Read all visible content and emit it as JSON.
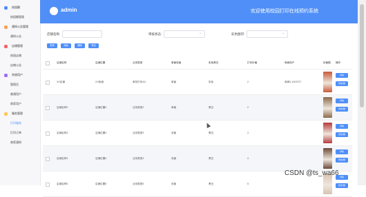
{
  "header": {
    "logo_text": "admin",
    "title": "欢迎使用校园打印在线预约系统"
  },
  "sidebar": {
    "groups": [
      {
        "label": "校园圈",
        "color": "#4f8ff7",
        "items": [
          {
            "label": "校园圈管理",
            "active": false
          }
        ]
      },
      {
        "label": "通知公告管理",
        "color": "#f7a04f",
        "items": [
          {
            "label": "通知公告",
            "active": false
          }
        ]
      },
      {
        "label": "店铺管理",
        "color": "#f76262",
        "items": [
          {
            "label": "校园店铺",
            "active": false
          },
          {
            "label": "店铺公告",
            "active": false
          }
        ]
      },
      {
        "label": "系统用户",
        "color": "#9b6cf7",
        "items": [
          {
            "label": "管理员",
            "active": false
          },
          {
            "label": "普通用户",
            "active": false
          },
          {
            "label": "商家用户",
            "active": false
          }
        ]
      },
      {
        "label": "服务管理",
        "color": "#f7c94f",
        "items": [
          {
            "label": "打印服务",
            "active": true
          },
          {
            "label": "打印订单",
            "active": false
          },
          {
            "label": "商家通知",
            "active": false
          }
        ]
      }
    ]
  },
  "search": {
    "field1_label": "店铺名称:",
    "field2_label": "审核状态:",
    "field3_label": "彩色图印:"
  },
  "toolbar": {
    "query": "查询",
    "add": "添加",
    "delete": "删除",
    "export": "导出"
  },
  "table": {
    "headers": [
      "店铺名称",
      "店铺位置",
      "业务类型",
      "单面双面",
      "彩色黑白",
      "打印价格",
      "商家用户",
      "封面图",
      "操作"
    ],
    "rows": [
      {
        "name": "XX店铺",
        "loc": "XX街道",
        "type": "单张打印A3",
        "side": "单面",
        "color": "彩色",
        "price": "2",
        "user": "商家0-1003727",
        "thumb": "#c75a3a"
      },
      {
        "name": "店铺名称2",
        "loc": "店铺位置2",
        "type": "业务类型2",
        "side": "单面",
        "color": "黑白",
        "price": "2",
        "user": "",
        "thumb": "#8a6a4a"
      },
      {
        "name": "店铺名称3",
        "loc": "店铺位置3",
        "type": "业务类型3",
        "side": "双面",
        "color": "黑白",
        "price": "3",
        "user": "",
        "thumb": "#b53c3c"
      },
      {
        "name": "店铺名称4",
        "loc": "店铺位置4",
        "type": "业务类型4",
        "side": "双面",
        "color": "黑白",
        "price": "4",
        "user": "",
        "thumb": "#6b4a3a"
      },
      {
        "name": "店铺名称5",
        "loc": "店铺位置5",
        "type": "业务类型5",
        "side": "双面",
        "color": "黑白",
        "price": "5",
        "user": "",
        "thumb": "#d7c3b2"
      }
    ],
    "row_actions": {
      "detail": "详情",
      "edit": "修改/删"
    }
  },
  "watermark": "CSDN @ts_wa66"
}
